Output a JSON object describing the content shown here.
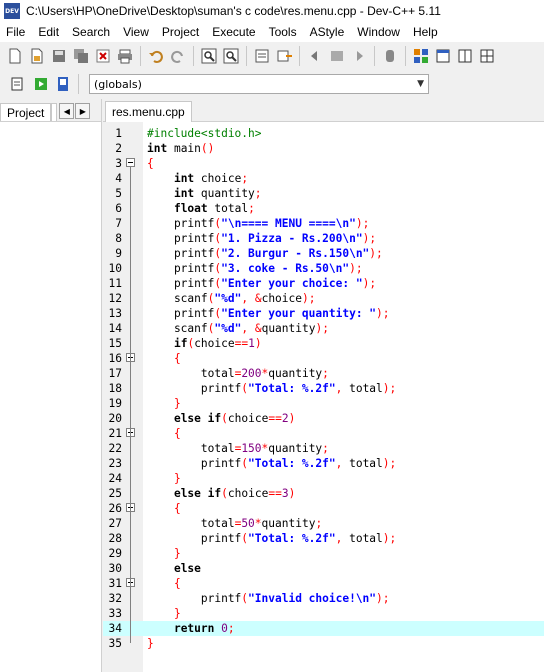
{
  "window": {
    "title": "C:\\Users\\HP\\OneDrive\\Desktop\\suman's c code\\res.menu.cpp - Dev-C++ 5.11",
    "icon_label": "DEV"
  },
  "menu": [
    "File",
    "Edit",
    "Search",
    "View",
    "Project",
    "Execute",
    "Tools",
    "AStyle",
    "Window",
    "Help"
  ],
  "toolbar": {
    "row1_icons": [
      "new-file-icon",
      "open-file-icon",
      "save-icon",
      "save-all-icon",
      "close-icon",
      "print-icon",
      "undo-icon",
      "redo-icon",
      "find-icon",
      "replace-icon",
      "goto-line-icon",
      "indent-icon",
      "unindent-icon",
      "toggle-bookmark-icon",
      "next-bookmark-icon",
      "prev-bookmark-icon",
      "new-class-icon",
      "insert-icon",
      "layout-icon",
      "grid-icon"
    ],
    "row2_icons": [
      "compile-icon",
      "run-icon",
      "compile-run-icon"
    ],
    "scope_combo": "(globals)"
  },
  "left_panel": {
    "tab_label": "Project"
  },
  "editor": {
    "tab_label": "res.menu.cpp",
    "current_line": 34,
    "lines": [
      {
        "n": "1",
        "text": "#include<stdio.h>"
      },
      {
        "n": "2",
        "text": "int main()"
      },
      {
        "n": "3",
        "text": "{"
      },
      {
        "n": "4",
        "text": "    int choice;"
      },
      {
        "n": "5",
        "text": "    int quantity;"
      },
      {
        "n": "6",
        "text": "    float total;"
      },
      {
        "n": "7",
        "text": "    printf(\"\\n==== MENU ====\\n\");"
      },
      {
        "n": "8",
        "text": "    printf(\"1. Pizza - Rs.200\\n\");"
      },
      {
        "n": "9",
        "text": "    printf(\"2. Burgur - Rs.150\\n\");"
      },
      {
        "n": "10",
        "text": "    printf(\"3. coke - Rs.50\\n\");"
      },
      {
        "n": "11",
        "text": "    printf(\"Enter your choice: \");"
      },
      {
        "n": "12",
        "text": "    scanf(\"%d\", &choice);"
      },
      {
        "n": "13",
        "text": "    printf(\"Enter your quantity: \");"
      },
      {
        "n": "14",
        "text": "    scanf(\"%d\", &quantity);"
      },
      {
        "n": "15",
        "text": "    if(choice==1)"
      },
      {
        "n": "16",
        "text": "    {"
      },
      {
        "n": "17",
        "text": "        total=200*quantity;"
      },
      {
        "n": "18",
        "text": "        printf(\"Total: %.2f\", total);"
      },
      {
        "n": "19",
        "text": "    }"
      },
      {
        "n": "20",
        "text": "    else if(choice==2)"
      },
      {
        "n": "21",
        "text": "    {"
      },
      {
        "n": "22",
        "text": "        total=150*quantity;"
      },
      {
        "n": "23",
        "text": "        printf(\"Total: %.2f\", total);"
      },
      {
        "n": "24",
        "text": "    }"
      },
      {
        "n": "25",
        "text": "    else if(choice==3)"
      },
      {
        "n": "26",
        "text": "    {"
      },
      {
        "n": "27",
        "text": "        total=50*quantity;"
      },
      {
        "n": "28",
        "text": "        printf(\"Total: %.2f\", total);"
      },
      {
        "n": "29",
        "text": "    }"
      },
      {
        "n": "30",
        "text": "    else"
      },
      {
        "n": "31",
        "text": "    {"
      },
      {
        "n": "32",
        "text": "        printf(\"Invalid choice!\\n\");"
      },
      {
        "n": "33",
        "text": "    }"
      },
      {
        "n": "34",
        "text": "    return 0;"
      },
      {
        "n": "35",
        "text": "}"
      }
    ],
    "fold_lines": [
      3,
      16,
      21,
      26,
      31
    ]
  }
}
